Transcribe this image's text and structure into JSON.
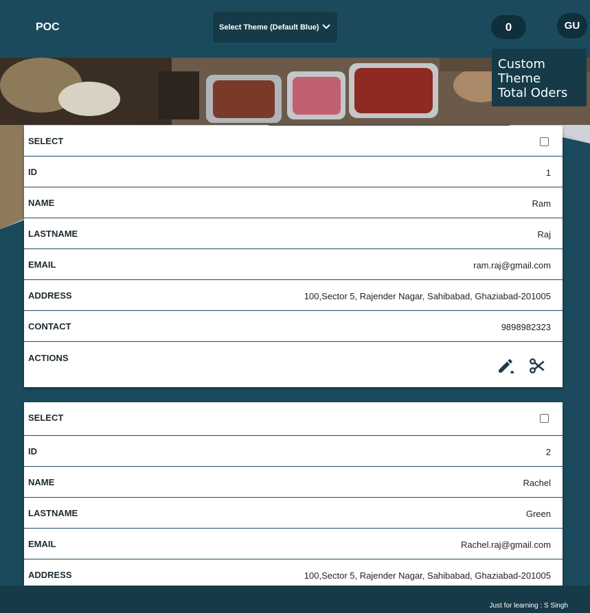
{
  "header": {
    "brand": "POC",
    "theme_select": "Select Theme (Default Blue)",
    "cart_count": "0",
    "avatar": "GU"
  },
  "dropdown": {
    "items": [
      "Custom Theme",
      "Total Oders"
    ]
  },
  "labels": {
    "select": "SELECT",
    "id": "ID",
    "name": "NAME",
    "lastname": "LASTNAME",
    "email": "EMAIL",
    "address": "ADDRESS",
    "contact": "CONTACT",
    "actions": "ACTIONS"
  },
  "records": [
    {
      "id": "1",
      "name": "Ram",
      "lastname": "Raj",
      "email": "ram.raj@gmail.com",
      "address": "100,Sector 5, Rajender Nagar, Sahibabad, Ghaziabad-201005",
      "contact": "9898982323"
    },
    {
      "id": "2",
      "name": "Rachel",
      "lastname": "Green",
      "email": "Rachel.raj@gmail.com",
      "address": "100,Sector 5, Rajender Nagar, Sahibabad, Ghaziabad-201005"
    }
  ],
  "icons": {
    "edit": "pencil-icon",
    "delete": "scissors-icon",
    "theme": "chevron-down-icon"
  },
  "colors": {
    "primary": "#1b4a5c",
    "dark": "#163a47"
  },
  "footer": {
    "credit": "Just for learning : S Singh"
  }
}
